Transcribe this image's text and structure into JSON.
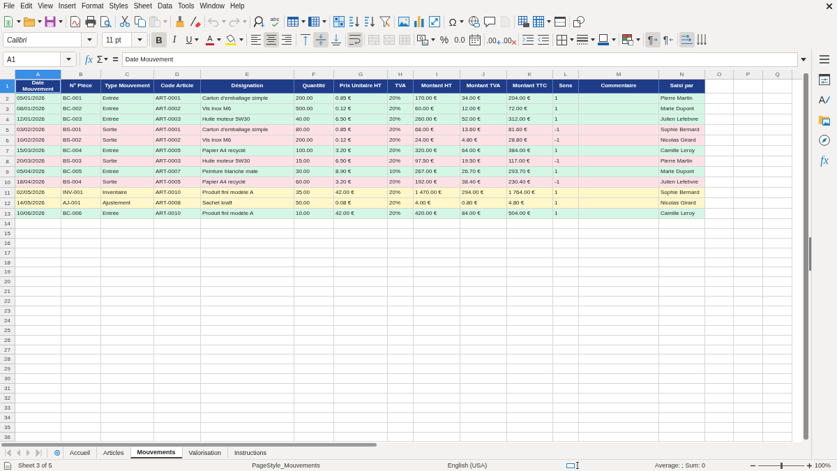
{
  "menu": [
    "File",
    "Edit",
    "View",
    "Insert",
    "Format",
    "Styles",
    "Sheet",
    "Data",
    "Tools",
    "Window",
    "Help"
  ],
  "standard_toolbar": [
    [
      {
        "kind": "new",
        "dropdown": true,
        "disabled": false
      },
      {
        "kind": "open",
        "dropdown": true,
        "disabled": false
      },
      {
        "kind": "save",
        "dropdown": true,
        "disabled": false
      }
    ],
    [
      {
        "kind": "export_pdf",
        "disabled": false
      },
      {
        "kind": "print",
        "disabled": false
      },
      {
        "kind": "print_preview",
        "disabled": false
      }
    ],
    [
      {
        "kind": "cut",
        "disabled": false
      },
      {
        "kind": "copy",
        "disabled": false
      },
      {
        "kind": "paste",
        "dropdown": true,
        "disabled": true
      }
    ],
    [
      {
        "kind": "clone_formatting",
        "disabled": false
      },
      {
        "kind": "clear_formatting",
        "disabled": false
      }
    ],
    [
      {
        "kind": "undo",
        "dropdown": true,
        "disabled": true
      },
      {
        "kind": "redo",
        "dropdown": true,
        "disabled": true
      }
    ],
    [
      {
        "kind": "find_replace",
        "disabled": false
      },
      {
        "kind": "spelling",
        "glyph": "abc",
        "disabled": false
      }
    ],
    [
      {
        "kind": "rows",
        "dropdown": true,
        "disabled": false
      },
      {
        "kind": "columns",
        "dropdown": true,
        "disabled": false
      }
    ],
    [
      {
        "kind": "sort",
        "disabled": false
      },
      {
        "kind": "sort_ascending",
        "disabled": false
      },
      {
        "kind": "sort_descending",
        "disabled": false
      },
      {
        "kind": "autofilter",
        "disabled": false
      }
    ],
    [
      {
        "kind": "image",
        "disabled": false
      },
      {
        "kind": "chart",
        "disabled": false
      },
      {
        "kind": "pivot_table",
        "disabled": false
      }
    ],
    [
      {
        "kind": "special_character",
        "glyph": "Ω",
        "dropdown": true,
        "disabled": false
      },
      {
        "kind": "hyperlink",
        "disabled": false
      },
      {
        "kind": "comment",
        "disabled": false
      },
      {
        "kind": "header_footer",
        "disabled": true
      }
    ],
    [
      {
        "kind": "print_area",
        "disabled": false
      },
      {
        "kind": "freeze",
        "dropdown": true,
        "disabled": false
      },
      {
        "kind": "split_window",
        "disabled": false
      }
    ],
    [
      {
        "kind": "draw_functions",
        "disabled": false
      }
    ]
  ],
  "format_toolbar": {
    "font_name": "Calibri",
    "font_size": "11 pt",
    "groups": [
      [
        {
          "kind": "bold",
          "glyph": "B",
          "on": true,
          "disabled": false
        },
        {
          "kind": "italic",
          "glyph": "I",
          "on": false,
          "disabled": false
        },
        {
          "kind": "underline",
          "glyph": "U",
          "dropdown": true,
          "on": false,
          "disabled": false
        },
        {
          "kind": "font_color",
          "glyph": "A",
          "dropdown": true,
          "on": false,
          "disabled": false
        },
        {
          "kind": "highlight",
          "dropdown": true,
          "on": false,
          "disabled": false
        }
      ],
      [
        {
          "kind": "align_left",
          "on": false,
          "disabled": false
        },
        {
          "kind": "align_center",
          "on": true,
          "disabled": false
        },
        {
          "kind": "align_right",
          "on": false,
          "disabled": false
        }
      ],
      [
        {
          "kind": "valign_top",
          "on": false,
          "disabled": false
        },
        {
          "kind": "valign_center",
          "on": true,
          "disabled": false
        },
        {
          "kind": "valign_bottom",
          "on": false,
          "disabled": false
        }
      ],
      [
        {
          "kind": "wrap",
          "on": true,
          "disabled": false
        }
      ],
      [
        {
          "kind": "merge_center",
          "on": false,
          "disabled": true
        },
        {
          "kind": "merge",
          "on": false,
          "disabled": true
        },
        {
          "kind": "unmerge",
          "on": false,
          "disabled": true
        }
      ],
      [
        {
          "kind": "currency",
          "dropdown": true,
          "on": false,
          "disabled": false
        },
        {
          "kind": "percent",
          "glyph": "%",
          "on": false,
          "disabled": false
        },
        {
          "kind": "number",
          "glyph": "0.0",
          "on": false,
          "disabled": false
        },
        {
          "kind": "date",
          "on": false,
          "disabled": false
        }
      ],
      [
        {
          "kind": "add_decimal",
          "glyph": ".00",
          "on": false,
          "disabled": false
        },
        {
          "kind": "delete_decimal",
          "glyph": ".00",
          "on": false,
          "disabled": false
        }
      ],
      [
        {
          "kind": "indent",
          "on": false,
          "disabled": false
        },
        {
          "kind": "outdent",
          "on": false,
          "disabled": false
        }
      ],
      [
        {
          "kind": "borders",
          "dropdown": true,
          "on": false,
          "disabled": false
        },
        {
          "kind": "border_style",
          "dropdown": true,
          "on": false,
          "disabled": false
        },
        {
          "kind": "border_color",
          "dropdown": true,
          "on": false,
          "disabled": false
        }
      ],
      [
        {
          "kind": "conditional",
          "dropdown": true,
          "on": false,
          "disabled": false
        }
      ],
      [
        {
          "kind": "left_to_right",
          "glyph": "¶",
          "on": true,
          "disabled": false
        },
        {
          "kind": "right_to_left",
          "glyph": "¶",
          "on": false,
          "disabled": false
        }
      ],
      [
        {
          "kind": "text_direction",
          "on": true,
          "disabled": false
        },
        {
          "kind": "stacked",
          "on": false,
          "disabled": false
        }
      ]
    ]
  },
  "formula_bar": {
    "name_box": "A1",
    "function_wizard": "fx",
    "sum": "Σ",
    "equals": "=",
    "content": "Date Mouvement"
  },
  "sidebar": [
    {
      "kind": "menu"
    },
    {
      "kind": "properties"
    },
    {
      "kind": "styles",
      "glyph": "A"
    },
    {
      "kind": "gallery"
    },
    {
      "kind": "navigator"
    },
    {
      "kind": "functions",
      "glyph": "fx"
    }
  ],
  "sheet": {
    "columns": [
      {
        "label": "A",
        "selected": true
      },
      {
        "label": "B",
        "selected": false
      },
      {
        "label": "C",
        "selected": false
      },
      {
        "label": "D",
        "selected": false
      },
      {
        "label": "E",
        "selected": false
      },
      {
        "label": "F",
        "selected": false
      },
      {
        "label": "G",
        "selected": false
      },
      {
        "label": "H",
        "selected": false
      },
      {
        "label": "I",
        "selected": false
      },
      {
        "label": "J",
        "selected": false
      },
      {
        "label": "K",
        "selected": false
      },
      {
        "label": "L",
        "selected": false
      },
      {
        "label": "M",
        "selected": false
      },
      {
        "label": "N",
        "selected": false
      },
      {
        "label": "O",
        "selected": false
      },
      {
        "label": "P",
        "selected": false
      },
      {
        "label": "Q",
        "selected": false
      }
    ],
    "row_numbers": [
      {
        "label": "1",
        "selected": true
      },
      {
        "label": "2",
        "selected": false
      },
      {
        "label": "3",
        "selected": false
      },
      {
        "label": "4",
        "selected": false
      },
      {
        "label": "5",
        "selected": false
      },
      {
        "label": "6",
        "selected": false
      },
      {
        "label": "7",
        "selected": false
      },
      {
        "label": "8",
        "selected": false
      },
      {
        "label": "9",
        "selected": false
      },
      {
        "label": "10",
        "selected": false
      },
      {
        "label": "11",
        "selected": false
      },
      {
        "label": "12",
        "selected": false
      },
      {
        "label": "13",
        "selected": false
      },
      {
        "label": "14",
        "selected": false
      },
      {
        "label": "15",
        "selected": false
      },
      {
        "label": "16",
        "selected": false
      },
      {
        "label": "17",
        "selected": false
      },
      {
        "label": "18",
        "selected": false
      },
      {
        "label": "19",
        "selected": false
      },
      {
        "label": "20",
        "selected": false
      },
      {
        "label": "21",
        "selected": false
      },
      {
        "label": "22",
        "selected": false
      },
      {
        "label": "23",
        "selected": false
      },
      {
        "label": "24",
        "selected": false
      },
      {
        "label": "25",
        "selected": false
      },
      {
        "label": "26",
        "selected": false
      },
      {
        "label": "27",
        "selected": false
      },
      {
        "label": "28",
        "selected": false
      },
      {
        "label": "29",
        "selected": false
      },
      {
        "label": "30",
        "selected": false
      },
      {
        "label": "31",
        "selected": false
      },
      {
        "label": "32",
        "selected": false
      },
      {
        "label": "33",
        "selected": false
      },
      {
        "label": "34",
        "selected": false
      },
      {
        "label": "35",
        "selected": false
      },
      {
        "label": "36",
        "selected": false
      }
    ],
    "header": [
      "Date Mouvement",
      "N° Pièce",
      "Type Mouvement",
      "Code Article",
      "Désignation",
      "Quantité",
      "Prix Unitaire HT",
      "TVA",
      "Montant HT",
      "Montant TVA",
      "Montant TTC",
      "Sens",
      "Commentaire",
      "Saisi par"
    ],
    "rows": [
      {
        "color": "#d4f6e5",
        "date": "05/01/2026",
        "piece": "BC-001",
        "type": "Entrée",
        "article": "ART-0001",
        "designation": "Carton d'emballage simple",
        "quantite": "200.00",
        "prix_unitaire": "0.85 €",
        "tva": "20%",
        "montant_ht": "170.00 €",
        "montant_tva": "34.00 €",
        "montant_ttc": "204.00 €",
        "sens": "1",
        "saisi_par": "Pierre Martin"
      },
      {
        "color": "#d4f6e5",
        "date": "08/01/2026",
        "piece": "BC-002",
        "type": "Entrée",
        "article": "ART-0002",
        "designation": "Vis inox M6",
        "quantite": "500.00",
        "prix_unitaire": "0.12 €",
        "tva": "20%",
        "montant_ht": "60.00 €",
        "montant_tva": "12.00 €",
        "montant_ttc": "72.00 €",
        "sens": "1",
        "saisi_par": "Marie Dupont"
      },
      {
        "color": "#d4f6e5",
        "date": "12/01/2026",
        "piece": "BC-003",
        "type": "Entrée",
        "article": "ART-0003",
        "designation": "Huile moteur 5W30",
        "quantite": "40.00",
        "prix_unitaire": "6.50 €",
        "tva": "20%",
        "montant_ht": "260.00 €",
        "montant_tva": "52.00 €",
        "montant_ttc": "312.00 €",
        "sens": "1",
        "saisi_par": "Julien Lefebvre"
      },
      {
        "color": "#fde2e5",
        "date": "03/02/2026",
        "piece": "BS-001",
        "type": "Sortie",
        "article": "ART-0001",
        "designation": "Carton d'emballage simple",
        "quantite": "80.00",
        "prix_unitaire": "0.85 €",
        "tva": "20%",
        "montant_ht": "68.00 €",
        "montant_tva": "13.60 €",
        "montant_ttc": "81.60 €",
        "sens": "-1",
        "saisi_par": "Sophie Bernard"
      },
      {
        "color": "#fde2e5",
        "date": "10/02/2026",
        "piece": "BS-002",
        "type": "Sortie",
        "article": "ART-0002",
        "designation": "Vis inox M6",
        "quantite": "200.00",
        "prix_unitaire": "0.12 €",
        "tva": "20%",
        "montant_ht": "24.00 €",
        "montant_tva": "4.80 €",
        "montant_ttc": "28.80 €",
        "sens": "-1",
        "saisi_par": "Nicolas Girard"
      },
      {
        "color": "#d4f6e5",
        "date": "15/03/2026",
        "piece": "BC-004",
        "type": "Entrée",
        "article": "ART-0005",
        "designation": "Papier A4 recyclé",
        "quantite": "100.00",
        "prix_unitaire": "3.20 €",
        "tva": "20%",
        "montant_ht": "320.00 €",
        "montant_tva": "64.00 €",
        "montant_ttc": "384.00 €",
        "sens": "1",
        "saisi_par": "Camille Leroy"
      },
      {
        "color": "#fde2e5",
        "date": "20/03/2026",
        "piece": "BS-003",
        "type": "Sortie",
        "article": "ART-0003",
        "designation": "Huile moteur 5W30",
        "quantite": "15.00",
        "prix_unitaire": "6.50 €",
        "tva": "20%",
        "montant_ht": "97.50 €",
        "montant_tva": "19.50 €",
        "montant_ttc": "117.00 €",
        "sens": "-1",
        "saisi_par": "Pierre Martin"
      },
      {
        "color": "#d4f6e5",
        "date": "05/04/2026",
        "piece": "BC-005",
        "type": "Entrée",
        "article": "ART-0007",
        "designation": "Peinture blanche mate",
        "quantite": "30.00",
        "prix_unitaire": "8.90 €",
        "tva": "10%",
        "montant_ht": "267.00 €",
        "montant_tva": "26.70 €",
        "montant_ttc": "293.70 €",
        "sens": "1",
        "saisi_par": "Marie Dupont"
      },
      {
        "color": "#fde2e5",
        "date": "18/04/2026",
        "piece": "BS-004",
        "type": "Sortie",
        "article": "ART-0005",
        "designation": "Papier A4 recyclé",
        "quantite": "60.00",
        "prix_unitaire": "3.20 €",
        "tva": "20%",
        "montant_ht": "192.00 €",
        "montant_tva": "38.40 €",
        "montant_ttc": "230.40 €",
        "sens": "-1",
        "saisi_par": "Julien Lefebvre"
      },
      {
        "color": "#fff7c9",
        "date": "02/05/2026",
        "piece": "INV-001",
        "type": "Inventaire",
        "article": "ART-0010",
        "designation": "Produit fini modèle A",
        "quantite": "35.00",
        "prix_unitaire": "42.00 €",
        "tva": "20%",
        "montant_ht": "1 470.00 €",
        "montant_tva": "294.00 €",
        "montant_ttc": "1 764.00 €",
        "sens": "1",
        "saisi_par": "Sophie Bernard"
      },
      {
        "color": "#fff7c9",
        "date": "14/05/2026",
        "piece": "AJ-001",
        "type": "Ajustement",
        "article": "ART-0008",
        "designation": "Sachet kraft",
        "quantite": "50.00",
        "prix_unitaire": "0.08 €",
        "tva": "20%",
        "montant_ht": "4.00 €",
        "montant_tva": "0.80 €",
        "montant_ttc": "4.80 €",
        "sens": "1",
        "saisi_par": "Nicolas Girard"
      },
      {
        "color": "#d4f6e5",
        "date": "10/06/2026",
        "piece": "BC-006",
        "type": "Entrée",
        "article": "ART-0010",
        "designation": "Produit fini modèle A",
        "quantite": "10.00",
        "prix_unitaire": "42.00 €",
        "tva": "20%",
        "montant_ht": "420.00 €",
        "montant_tva": "84.00 €",
        "montant_ttc": "504.00 €",
        "sens": "1",
        "saisi_par": "Camille Leroy"
      }
    ]
  },
  "sheet_tabs": [
    {
      "label": "Accueil",
      "selected": false
    },
    {
      "label": "Articles",
      "selected": false
    },
    {
      "label": "Mouvements",
      "selected": true
    },
    {
      "label": "Valorisation",
      "selected": false
    },
    {
      "label": "Instructions",
      "selected": false
    }
  ],
  "status_bar": {
    "sheet": "Sheet 3 of 5",
    "page_style": "PageStyle_Mouvements",
    "language": "English (USA)",
    "selection_summary": "Average: ; Sum: 0",
    "zoom": {
      "level": 0.5,
      "reading": "100%"
    }
  }
}
